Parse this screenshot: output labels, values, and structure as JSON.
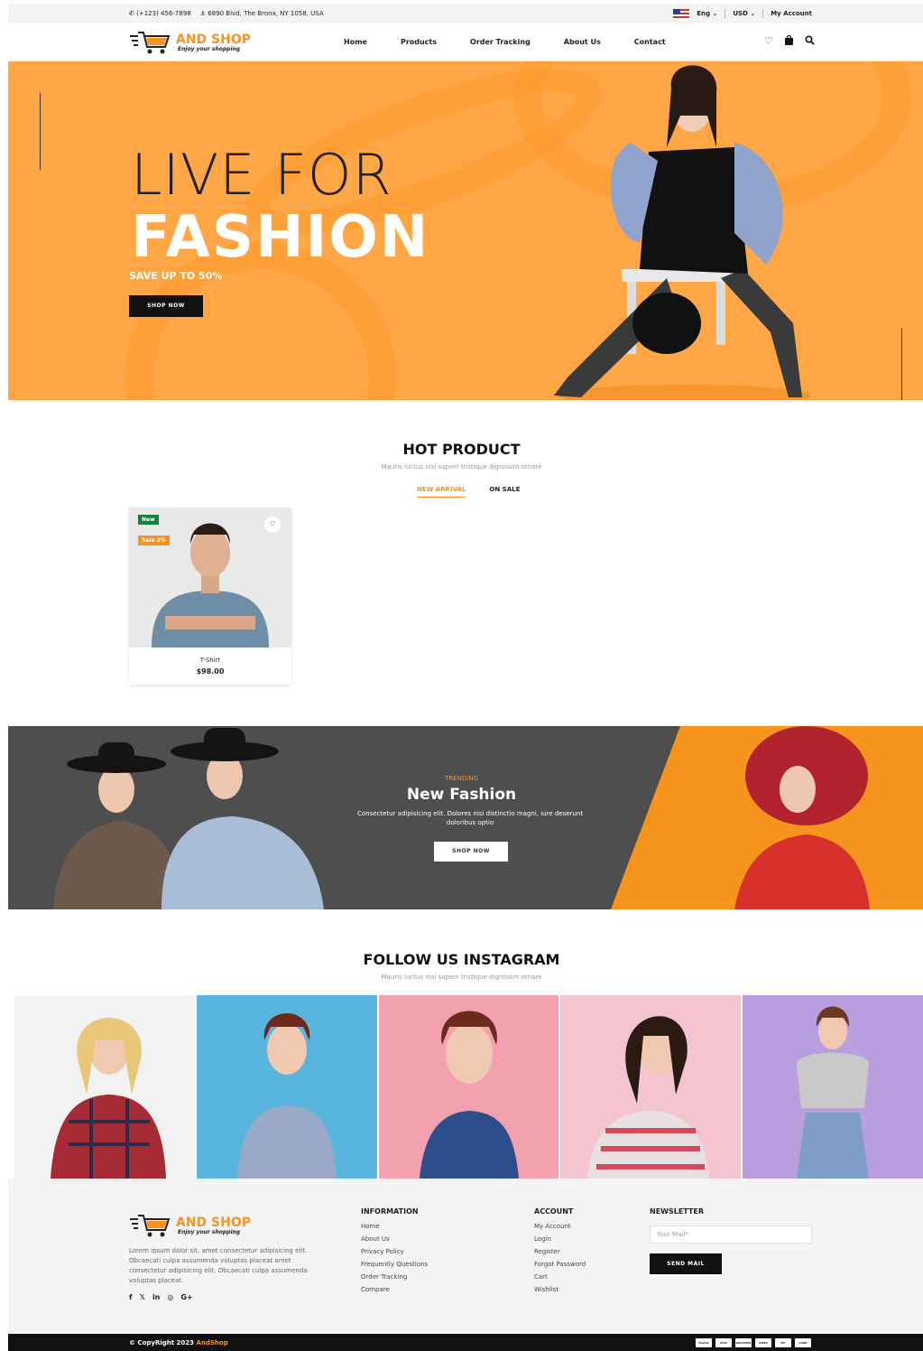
{
  "topbar": {
    "phone": "(+123) 456-7898",
    "address": "6890 Blvd, The Bronx, NY 1058, USA",
    "language": "Eng",
    "currency": "USD",
    "account": "My Account"
  },
  "brand": {
    "name": "AND SHOP",
    "tagline": "Enjoy your shopping",
    "accent": "#f7941d"
  },
  "nav": {
    "items": [
      "Home",
      "Products",
      "Order Tracking",
      "About Us",
      "Contact"
    ],
    "icons": [
      "heart-icon",
      "bag-icon",
      "search-icon"
    ]
  },
  "hero": {
    "line1": "LIVE FOR",
    "line2": "FASHION",
    "offer": "SAVE UP TO 50%",
    "button": "SHOP NOW",
    "background": "#ffa646"
  },
  "hot_product": {
    "title": "HOT PRODUCT",
    "subtitle": "Mauris luctus nisi sapien tristique dignissim ornare",
    "tabs": [
      "NEW ARRIVAL",
      "ON SALE"
    ],
    "active_tab": "NEW ARRIVAL",
    "products": [
      {
        "name": "T-Shirt",
        "price": "$98.00",
        "badge_new": "New",
        "badge_sale": "Sale 2%"
      }
    ]
  },
  "trending": {
    "label": "TRENDING",
    "title": "New Fashion",
    "description": "Consectetur adipisicing elit. Dolores nisi distinctio magni, iure deserunt doloribus optio",
    "button": "SHOP NOW"
  },
  "instagram": {
    "title": "FOLLOW US INSTAGRAM",
    "subtitle": "Mauris luctus nisi sapien tristique dignissim ornare",
    "tile_colors": [
      "#f2f2f2",
      "#59b4de",
      "#f3a1ae",
      "#f4c4d0",
      "#b99ee0"
    ]
  },
  "footer": {
    "about": "Lorem ipsum dolor sit, amet consectetur adipisicing elit. Obcaecati culpa assumenda voluptas placeat amet consectetur adipisicing elit. Obcaecati culpa assumenda voluptas placeat.",
    "social": [
      "f",
      "𝕏",
      "in",
      "◎",
      "G+"
    ],
    "information": {
      "title": "INFORMATION",
      "links": [
        "Home",
        "About Us",
        "Privacy Policy",
        "Frequently Questions",
        "Order Tracking",
        "Compare"
      ]
    },
    "account": {
      "title": "ACCOUNT",
      "links": [
        "My Account",
        "Login",
        "Register",
        "Forgot Password",
        "Cart",
        "Wishlist"
      ]
    },
    "newsletter": {
      "title": "NEWSLETTER",
      "placeholder": "Your Mail*",
      "button": "SEND MAIL"
    }
  },
  "bottom": {
    "copyright": "© CopyRight 2023 ",
    "brand": "AndShop",
    "payments": [
      "PayPal",
      "VISA",
      "DISCOVER",
      "AMEX",
      "MC",
      "CARD"
    ]
  }
}
